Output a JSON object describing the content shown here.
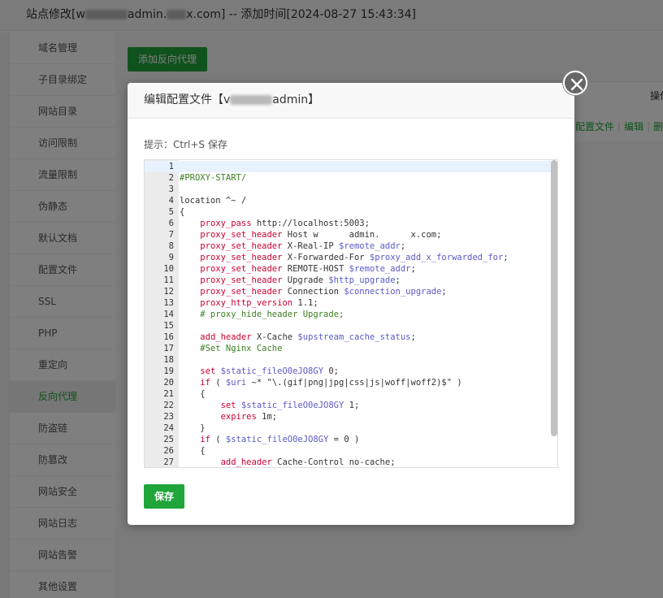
{
  "window": {
    "title_prefix": "站点修改[w",
    "title_mid": "admin.",
    "title_suffix": "x.com] -- 添加时间[2024-08-27 15:43:34]"
  },
  "sidebar": {
    "items": [
      {
        "label": "域名管理"
      },
      {
        "label": "子目录绑定"
      },
      {
        "label": "网站目录"
      },
      {
        "label": "访问限制"
      },
      {
        "label": "流量限制"
      },
      {
        "label": "伪静态"
      },
      {
        "label": "默认文档"
      },
      {
        "label": "配置文件"
      },
      {
        "label": "SSL"
      },
      {
        "label": "PHP"
      },
      {
        "label": "重定向"
      },
      {
        "label": "反向代理",
        "active": true
      },
      {
        "label": "防盗链"
      },
      {
        "label": "防篡改"
      },
      {
        "label": "网站安全"
      },
      {
        "label": "网站日志"
      },
      {
        "label": "网站告警"
      },
      {
        "label": "其他设置"
      }
    ]
  },
  "main": {
    "add_button": "添加反向代理",
    "table_header": "操作",
    "actions": [
      "配置文件",
      "编辑",
      "删除"
    ]
  },
  "modal": {
    "title_prefix": "编辑配置文件【v",
    "title_suffix": "admin】",
    "hint": "提示：Ctrl+S 保存",
    "save_button": "保存",
    "code_lines": [
      "",
      "#PROXY-START/",
      "",
      "location ^~ /",
      "{",
      "    proxy_pass http://localhost:5003;",
      "    proxy_set_header Host w      admin.      x.com;",
      "    proxy_set_header X-Real-IP $remote_addr;",
      "    proxy_set_header X-Forwarded-For $proxy_add_x_forwarded_for;",
      "    proxy_set_header REMOTE-HOST $remote_addr;",
      "    proxy_set_header Upgrade $http_upgrade;",
      "    proxy_set_header Connection $connection_upgrade;",
      "    proxy_http_version 1.1;",
      "    # proxy_hide_header Upgrade;",
      "",
      "    add_header X-Cache $upstream_cache_status;",
      "    #Set Nginx Cache",
      "",
      "    set $static_fileO0eJO8GY 0;",
      "    if ( $uri ~* \"\\.(gif|png|jpg|css|js|woff|woff2)$\" )",
      "    {",
      "        set $static_fileO0eJO8GY 1;",
      "        expires 1m;",
      "    }",
      "    if ( $static_fileO0eJO8GY = 0 )",
      "    {",
      "        add_header Cache-Control no-cache;"
    ]
  },
  "colors": {
    "accent": "#20a53a",
    "overlay": "rgba(0,0,0,0.5)"
  }
}
